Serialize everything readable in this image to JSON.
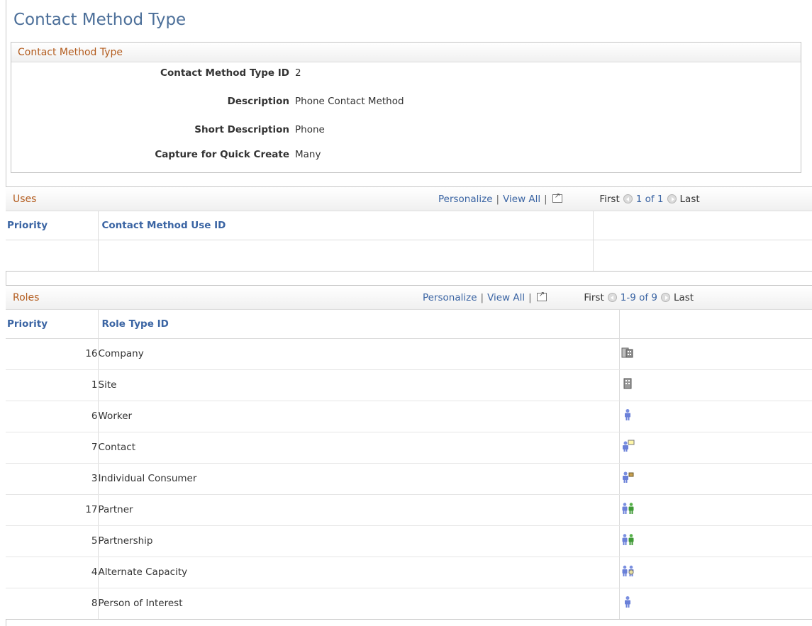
{
  "page_title": "Contact Method Type",
  "info_box": {
    "title": "Contact Method Type",
    "fields": [
      {
        "label": "Contact Method Type ID",
        "value": "2"
      },
      {
        "label": "Description",
        "value": "Phone Contact Method"
      },
      {
        "label": "Short Description",
        "value": "Phone"
      },
      {
        "label": "Capture for Quick Create",
        "value": "Many"
      }
    ]
  },
  "uses_grid": {
    "title": "Uses",
    "personalize": "Personalize",
    "view_all": "View All",
    "first": "First",
    "range": "1 of 1",
    "last": "Last",
    "columns": [
      "Priority",
      "Contact Method Use ID"
    ]
  },
  "roles_grid": {
    "title": "Roles",
    "personalize": "Personalize",
    "view_all": "View All",
    "first": "First",
    "range": "1-9 of 9",
    "last": "Last",
    "columns": [
      "Priority",
      "Role Type ID"
    ],
    "rows": [
      {
        "priority": "16",
        "role": "Company",
        "icon": "company-icon"
      },
      {
        "priority": "1",
        "role": "Site",
        "icon": "site-icon"
      },
      {
        "priority": "6",
        "role": "Worker",
        "icon": "worker-icon"
      },
      {
        "priority": "7",
        "role": "Contact",
        "icon": "contact-icon"
      },
      {
        "priority": "3",
        "role": "Individual Consumer",
        "icon": "individual-consumer-icon"
      },
      {
        "priority": "17",
        "role": "Partner",
        "icon": "partner-icon"
      },
      {
        "priority": "5",
        "role": "Partnership",
        "icon": "partnership-icon"
      },
      {
        "priority": "4",
        "role": "Alternate Capacity",
        "icon": "alternate-capacity-icon"
      },
      {
        "priority": "8",
        "role": "Person of Interest",
        "icon": "person-of-interest-icon"
      }
    ]
  },
  "colors": {
    "title": "#4c6f99",
    "section_title": "#b35c1e",
    "link": "#3a64a3"
  }
}
